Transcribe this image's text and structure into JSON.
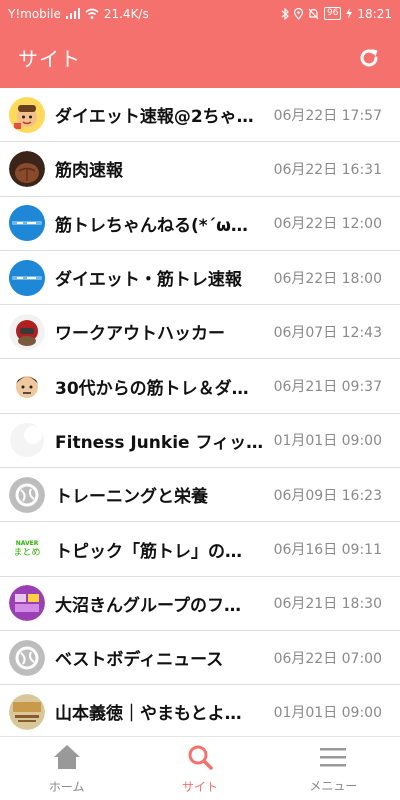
{
  "status_bar": {
    "carrier": "Y!mobile",
    "speed": "21.4K/s",
    "battery": "96",
    "time": "18:21"
  },
  "header": {
    "title": "サイト",
    "refresh_icon": "refresh-icon"
  },
  "sites": [
    {
      "name": "ダイエット速報@2ちゃ…",
      "date": "06月22日 17:57",
      "avatar": "cartoon-face"
    },
    {
      "name": "筋肉速報",
      "date": "06月22日 16:31",
      "avatar": "muscle-photo"
    },
    {
      "name": "筋トレちゃんねる(*´ω…",
      "date": "06月22日 12:00",
      "avatar": "blue-badge"
    },
    {
      "name": "ダイエット・筋トレ速報",
      "date": "06月22日 18:00",
      "avatar": "blue-badge"
    },
    {
      "name": "ワークアウトハッカー",
      "date": "06月07日 12:43",
      "avatar": "mascot"
    },
    {
      "name": "30代からの筋トレ＆ダ…",
      "date": "06月21日 09:37",
      "avatar": "cartoon-man"
    },
    {
      "name": "Fitness Junkie フィッ…",
      "date": "01月01日 09:00",
      "avatar": "blank"
    },
    {
      "name": "トレーニングと栄養",
      "date": "06月09日 16:23",
      "avatar": "grey-default"
    },
    {
      "name": "トピック「筋トレ」の…",
      "date": "06月16日 09:11",
      "avatar": "naver-matome"
    },
    {
      "name": "大沼きんグループのフ…",
      "date": "06月21日 18:30",
      "avatar": "purple-text"
    },
    {
      "name": "ベストボディニュース",
      "date": "06月22日 07:00",
      "avatar": "grey-default"
    },
    {
      "name": "山本義徳｜やまもとよ…",
      "date": "01月01日 09:00",
      "avatar": "text-image"
    }
  ],
  "naver_text": {
    "top": "NAVER",
    "bottom": "まとめ"
  },
  "tabs": [
    {
      "label": "ホーム",
      "icon": "home-icon",
      "active": false
    },
    {
      "label": "サイト",
      "icon": "search-icon",
      "active": true
    },
    {
      "label": "メニュー",
      "icon": "menu-icon",
      "active": false
    }
  ],
  "colors": {
    "accent": "#f5716d",
    "inactive": "#888888"
  }
}
